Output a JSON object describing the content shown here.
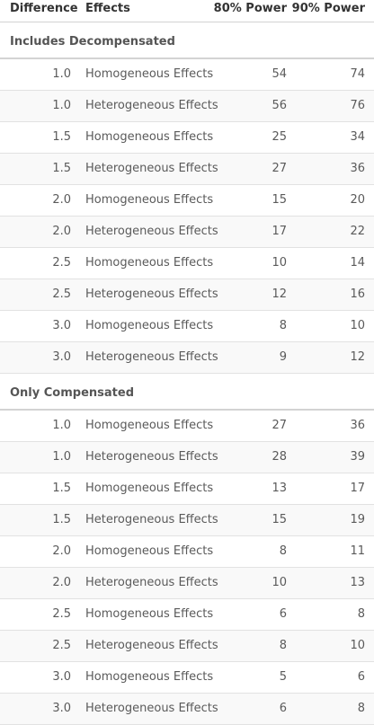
{
  "columns": {
    "difference": "Difference",
    "effects": "Effects",
    "power80": "80% Power",
    "power90": "90% Power"
  },
  "groups": [
    {
      "label": "Includes Decompensated",
      "rows": [
        {
          "difference": "1.0",
          "effects": "Homogeneous Effects",
          "power80": "54",
          "power90": "74"
        },
        {
          "difference": "1.0",
          "effects": "Heterogeneous Effects",
          "power80": "56",
          "power90": "76"
        },
        {
          "difference": "1.5",
          "effects": "Homogeneous Effects",
          "power80": "25",
          "power90": "34"
        },
        {
          "difference": "1.5",
          "effects": "Heterogeneous Effects",
          "power80": "27",
          "power90": "36"
        },
        {
          "difference": "2.0",
          "effects": "Homogeneous Effects",
          "power80": "15",
          "power90": "20"
        },
        {
          "difference": "2.0",
          "effects": "Heterogeneous Effects",
          "power80": "17",
          "power90": "22"
        },
        {
          "difference": "2.5",
          "effects": "Homogeneous Effects",
          "power80": "10",
          "power90": "14"
        },
        {
          "difference": "2.5",
          "effects": "Heterogeneous Effects",
          "power80": "12",
          "power90": "16"
        },
        {
          "difference": "3.0",
          "effects": "Homogeneous Effects",
          "power80": "8",
          "power90": "10"
        },
        {
          "difference": "3.0",
          "effects": "Heterogeneous Effects",
          "power80": "9",
          "power90": "12"
        }
      ]
    },
    {
      "label": "Only Compensated",
      "rows": [
        {
          "difference": "1.0",
          "effects": "Homogeneous Effects",
          "power80": "27",
          "power90": "36"
        },
        {
          "difference": "1.0",
          "effects": "Heterogeneous Effects",
          "power80": "28",
          "power90": "39"
        },
        {
          "difference": "1.5",
          "effects": "Homogeneous Effects",
          "power80": "13",
          "power90": "17"
        },
        {
          "difference": "1.5",
          "effects": "Heterogeneous Effects",
          "power80": "15",
          "power90": "19"
        },
        {
          "difference": "2.0",
          "effects": "Homogeneous Effects",
          "power80": "8",
          "power90": "11"
        },
        {
          "difference": "2.0",
          "effects": "Heterogeneous Effects",
          "power80": "10",
          "power90": "13"
        },
        {
          "difference": "2.5",
          "effects": "Homogeneous Effects",
          "power80": "6",
          "power90": "8"
        },
        {
          "difference": "2.5",
          "effects": "Heterogeneous Effects",
          "power80": "8",
          "power90": "10"
        },
        {
          "difference": "3.0",
          "effects": "Homogeneous Effects",
          "power80": "5",
          "power90": "6"
        },
        {
          "difference": "3.0",
          "effects": "Heterogeneous Effects",
          "power80": "6",
          "power90": "8"
        }
      ]
    }
  ]
}
